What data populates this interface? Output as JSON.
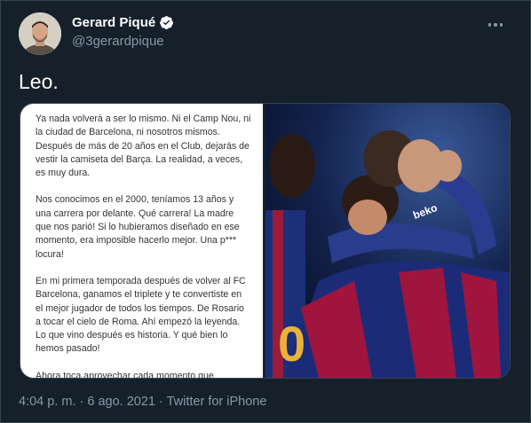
{
  "user": {
    "name": "Gerard Piqué",
    "handle": "@3gerardpique"
  },
  "tweet": {
    "text": "Leo."
  },
  "letter": {
    "paragraphs": [
      "Ya nada volverá a ser lo mismo. Ni el Camp Nou, ni la ciudad de Barcelona, ni nosotros mismos. Después de más de 20 años en el Club, dejarás de vestir la camiseta del Barça. La realidad, a veces, es muy dura.",
      "Nos conocimos en el 2000, teníamos 13 años y una carrera por delante. Qué carrera! La madre que nos parió! Si lo hubieramos diseñado en ese momento, era imposible hacerlo mejor. Una p*** locura!",
      "En mi primera temporada después de volver al FC Barcelona, ganamos el triplete y te convertiste en el mejor jugador de todos los tiempos. De Rosario a tocar el cielo de Roma. Ahí empezó la leyenda. Lo que vino después es historia. Y qué bien lo hemos pasado!",
      "Ahora toca aprovechar cada momento que"
    ]
  },
  "meta": {
    "time": "4:04 p. m.",
    "separator1": " · ",
    "date": "6 ago. 2021",
    "separator2": " · ",
    "source": "Twitter for iPhone"
  },
  "colors": {
    "background": "#15202b",
    "border": "#38444d",
    "secondary_text": "#8899a6",
    "verified": "#ffffff"
  },
  "icons": {
    "verified": "verified-badge-icon",
    "more": "more-options-icon"
  }
}
